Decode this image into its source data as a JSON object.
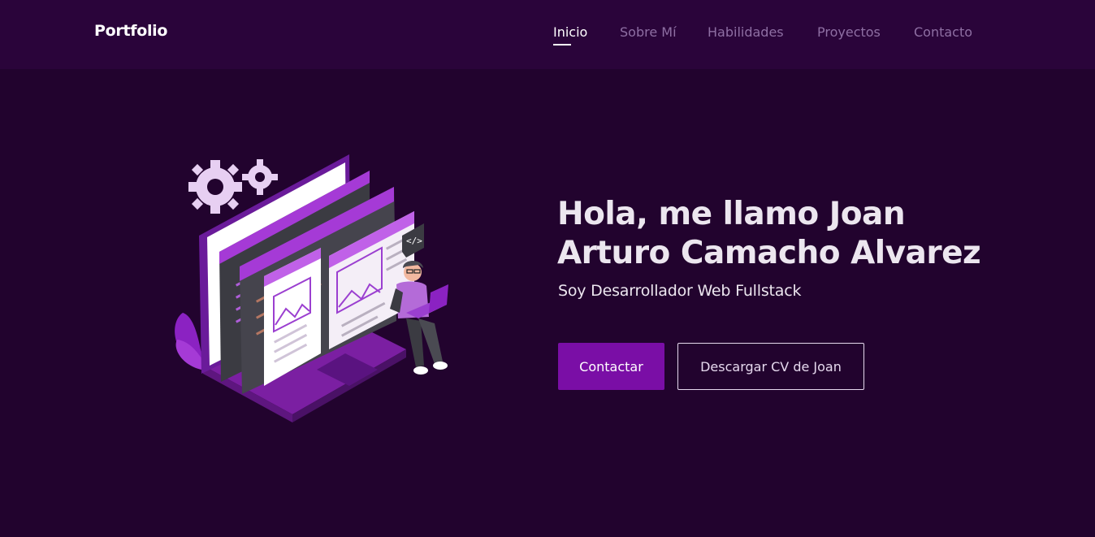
{
  "nav": {
    "brand": "Portfolio",
    "links": [
      {
        "label": "Inicio",
        "active": true
      },
      {
        "label": "Sobre Mí",
        "active": false
      },
      {
        "label": "Habilidades",
        "active": false
      },
      {
        "label": "Proyectos",
        "active": false
      },
      {
        "label": "Contacto",
        "active": false
      }
    ]
  },
  "hero": {
    "title_line1": "Hola, me llamo Joan",
    "title_line2": "Arturo Camacho Alvarez",
    "subtitle": "Soy Desarrollador Web Fullstack",
    "primary_button": "Contactar",
    "secondary_button": "Descargar CV de Joan",
    "illustration_code_tag": "</>"
  },
  "colors": {
    "nav_bg": "#2a043a",
    "page_bg": "#22032e",
    "accent": "#7a0ea6",
    "illustration_purple": "#9b3fd0",
    "text": "#ece6ef"
  },
  "icons": [
    "gear-icon",
    "code-icon",
    "image-icon",
    "laptop-icon"
  ]
}
